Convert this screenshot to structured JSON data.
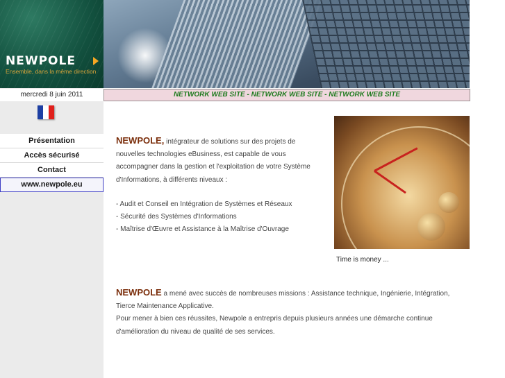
{
  "logo": {
    "name": "NEWPOLE",
    "tagline": "Ensemble, dans la même direction"
  },
  "date": "mercredi 8 juin 2011",
  "menu": [
    {
      "label": "Présentation"
    },
    {
      "label": "Accès sécurisé"
    },
    {
      "label": "Contact"
    },
    {
      "label": "www.newpole.eu"
    }
  ],
  "marquee": "NETWORK WEB SITE  -  NETWORK WEB SITE  -  NETWORK WEB SITE",
  "intro": {
    "brand": "NEWPOLE,",
    "text": " intégrateur de solutions sur des projets de nouvelles technologies eBusiness, est capable de vous accompagner dans la gestion et l'exploitation de votre Système d'Informations, à différents niveaux :"
  },
  "services": [
    "- Audit et Conseil en Intégration de Systèmes et Réseaux",
    "- Sécurité des Systèmes d'Informations",
    "- Maîtrise d'Œuvre et Assistance à la Maîtrise d'Ouvrage"
  ],
  "photo_caption": "Time is money ...",
  "para2": {
    "brand": "NEWPOLE",
    "line1": " a mené avec succès de nombreuses missions : Assistance technique, Ingénierie, Intégration, Tierce Maintenance Applicative.",
    "line2": "Pour mener à bien ces réussites, Newpole a entrepris depuis plusieurs années une démarche continue d'amélioration du niveau de qualité de ses services."
  },
  "colors": {
    "green": "#1d7a1d",
    "brand": "#7a2d0a",
    "menu_border": "#3b3bc4",
    "flag": [
      "#1d3fa3",
      "#ffffff",
      "#e0201c"
    ]
  }
}
